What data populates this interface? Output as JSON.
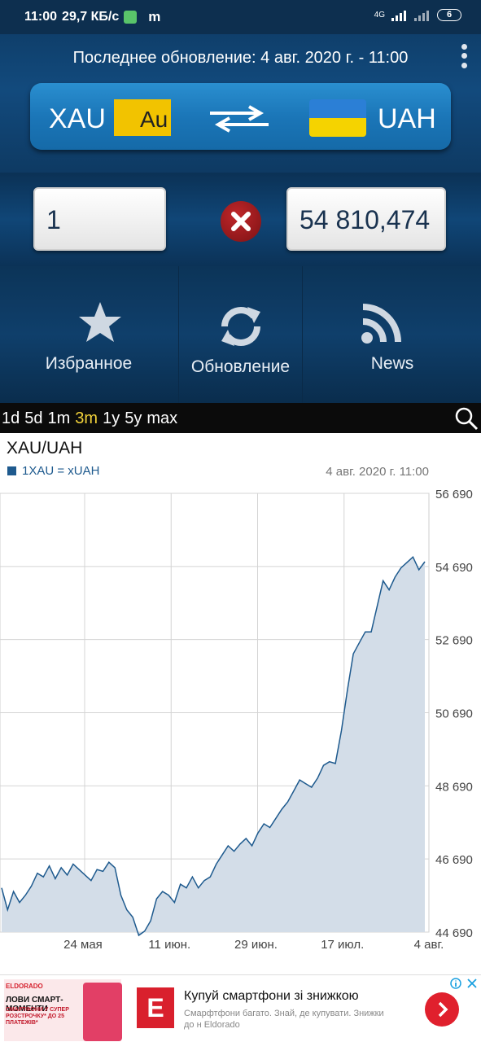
{
  "status_bar": {
    "time": "11:00",
    "speed": "29,7 КБ/с",
    "m_label": "m",
    "network": "4G",
    "battery": "6"
  },
  "header": {
    "last_update": "Последнее обновление: 4 авг. 2020 г. - 11:00",
    "from_code": "XAU",
    "from_badge": "Au",
    "to_code": "UAH",
    "colors": {
      "gold": "#f2c300",
      "flag_blue": "#2b7fd6",
      "flag_yellow": "#f5d300"
    }
  },
  "converter": {
    "amount": "1",
    "result": "54 810,474"
  },
  "actions": {
    "favorites": "Избранное",
    "refresh": "Обновление",
    "news": "News"
  },
  "periods": {
    "items": [
      "1d",
      "5d",
      "1m",
      "3m",
      "1y",
      "5y",
      "max"
    ],
    "active": "3m"
  },
  "chart_data": {
    "type": "area",
    "title": "XAU/UAH",
    "series": [
      {
        "name": "1XAU = xUAH",
        "color": "#1e5a8e"
      }
    ],
    "date_label": "4 авг. 2020 г. 11:00",
    "x_ticks": [
      "24 мая",
      "11 июн.",
      "29 июн.",
      "17 июл.",
      "4 авг."
    ],
    "y_ticks": [
      56690,
      54690,
      52690,
      50690,
      48690,
      46690,
      44690
    ],
    "y_tick_labels": [
      "56 690",
      "54 690",
      "52 690",
      "50 690",
      "48 690",
      "46 690",
      "44 690"
    ],
    "ylim": [
      44690,
      56690
    ],
    "grid": true,
    "points": [
      [
        0,
        45900
      ],
      [
        2,
        45300
      ],
      [
        4,
        45800
      ],
      [
        6,
        45500
      ],
      [
        8,
        45700
      ],
      [
        10,
        45950
      ],
      [
        12,
        46300
      ],
      [
        14,
        46200
      ],
      [
        16,
        46500
      ],
      [
        18,
        46150
      ],
      [
        20,
        46450
      ],
      [
        22,
        46250
      ],
      [
        24,
        46550
      ],
      [
        26,
        46400
      ],
      [
        28,
        46250
      ],
      [
        30,
        46100
      ],
      [
        32,
        46400
      ],
      [
        34,
        46350
      ],
      [
        36,
        46600
      ],
      [
        38,
        46450
      ],
      [
        40,
        45700
      ],
      [
        42,
        45300
      ],
      [
        44,
        45100
      ],
      [
        46,
        44600
      ],
      [
        48,
        44720
      ],
      [
        50,
        45000
      ],
      [
        52,
        45600
      ],
      [
        54,
        45800
      ],
      [
        56,
        45700
      ],
      [
        58,
        45500
      ],
      [
        60,
        46000
      ],
      [
        62,
        45900
      ],
      [
        64,
        46200
      ],
      [
        66,
        45900
      ],
      [
        68,
        46100
      ],
      [
        70,
        46200
      ],
      [
        72,
        46550
      ],
      [
        74,
        46800
      ],
      [
        76,
        47050
      ],
      [
        78,
        46900
      ],
      [
        80,
        47100
      ],
      [
        82,
        47250
      ],
      [
        84,
        47050
      ],
      [
        86,
        47400
      ],
      [
        88,
        47650
      ],
      [
        90,
        47550
      ],
      [
        92,
        47800
      ],
      [
        94,
        48050
      ],
      [
        96,
        48250
      ],
      [
        98,
        48550
      ],
      [
        100,
        48850
      ],
      [
        102,
        48750
      ],
      [
        104,
        48650
      ],
      [
        106,
        48900
      ],
      [
        108,
        49250
      ],
      [
        110,
        49350
      ],
      [
        112,
        49300
      ],
      [
        114,
        50200
      ],
      [
        116,
        51300
      ],
      [
        118,
        52300
      ],
      [
        120,
        52600
      ],
      [
        122,
        52900
      ],
      [
        124,
        52900
      ],
      [
        126,
        53600
      ],
      [
        128,
        54300
      ],
      [
        130,
        54050
      ],
      [
        132,
        54400
      ],
      [
        134,
        54650
      ],
      [
        136,
        54800
      ],
      [
        138,
        54950
      ],
      [
        140,
        54600
      ],
      [
        142,
        54820
      ]
    ]
  },
  "ad": {
    "brand": "ELDORADO",
    "promo": "ЛОВИ СМАРТ-МОМЕНТИ",
    "promo_sub": "СМАРТФОНИ У СУПЕР РОЗСТРОЧКУ* ДО 25 ПЛАТЕЖІВ*",
    "logo_letter": "E",
    "title": "Купуй смартфони зі знижкою",
    "description": "Смарфтфони багато. Знай, де купувати. Знижки до н Eldorado"
  }
}
